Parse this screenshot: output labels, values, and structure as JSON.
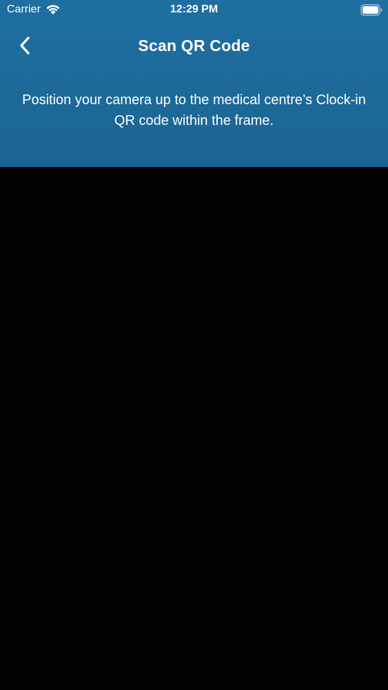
{
  "status_bar": {
    "carrier": "Carrier",
    "time": "12:29 PM"
  },
  "nav": {
    "title": "Scan QR Code",
    "back_icon": "chevron-left-icon"
  },
  "instruction": {
    "text": "Position your camera up to the medical centre’s Clock-in QR code within the frame."
  },
  "colors": {
    "header_background": "#1f6fa3",
    "camera_background": "#000000",
    "text": "#ffffff"
  }
}
